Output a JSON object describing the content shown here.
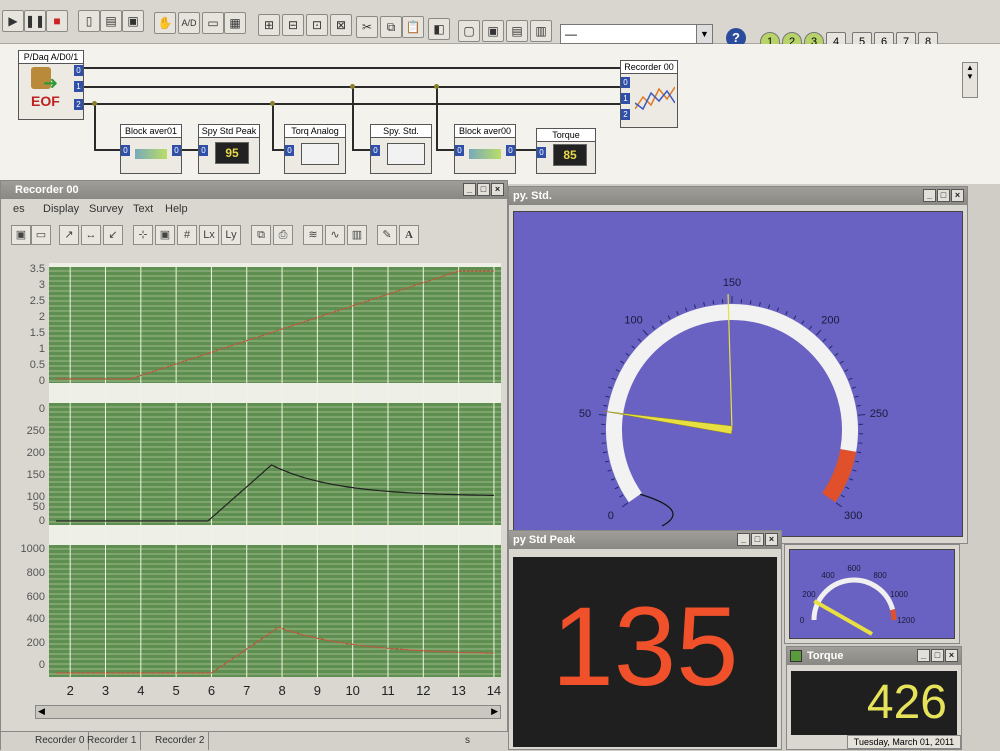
{
  "toolbar": {
    "icons": [
      "play-icon",
      "pause-icon",
      "stop-icon",
      "new-icon",
      "open-icon",
      "save-icon",
      "hand-icon",
      "ad-icon",
      "image-icon",
      "grid-icon",
      "layout1-icon",
      "layout2-icon",
      "layout3-icon",
      "cut-icon",
      "copy-icon",
      "paste-icon",
      "cube-icon",
      "win1-icon",
      "win2-icon",
      "win3-icon",
      "win4-icon"
    ],
    "combo_value": "—",
    "help_label": "?",
    "layers": [
      "1",
      "2",
      "3",
      "4",
      "5",
      "6",
      "7",
      "8"
    ]
  },
  "diagram": {
    "source": {
      "title": "P/Daq A/D0/1",
      "label": "EOF",
      "ports": [
        "0",
        "1",
        "2"
      ]
    },
    "recorder": {
      "title": "Recorder 00",
      "ports": [
        "0",
        "1",
        "2"
      ]
    },
    "blocks": [
      {
        "title": "Block aver01"
      },
      {
        "title": "Spy Std Peak",
        "value": "95"
      },
      {
        "title": "Torq Analog"
      },
      {
        "title": "Spy. Std."
      },
      {
        "title": "Block aver00"
      },
      {
        "title": "Torque",
        "value": "85"
      }
    ],
    "port_zero": "0"
  },
  "recorder_window": {
    "title": "Recorder 00",
    "menu": [
      "es",
      "Display",
      "Survey",
      "Text",
      "Help"
    ],
    "x_ticks": [
      "2",
      "3",
      "4",
      "5",
      "6",
      "7",
      "8",
      "9",
      "10",
      "11",
      "12",
      "13",
      "14"
    ],
    "panel1_ticks": [
      "3.5",
      "3",
      "2.5",
      "2",
      "1.5",
      "1",
      "0.5",
      "0"
    ],
    "panel2_ticks": [
      "0",
      "250",
      "200",
      "150",
      "100",
      "50",
      "0"
    ],
    "panel3_ticks": [
      "1000",
      "800",
      "600",
      "400",
      "200",
      "0"
    ],
    "tabs": [
      "Recorder 0",
      "Recorder 1",
      "Recorder 2"
    ],
    "unit": "s",
    "series_colors": [
      "#c8503a",
      "#222222",
      "#c8503a"
    ]
  },
  "gauge_window": {
    "title": "py. Std.",
    "ticks": [
      "0",
      "50",
      "100",
      "150",
      "200",
      "250",
      "300"
    ],
    "value": 52,
    "peak": 148,
    "background": "#6a62c2"
  },
  "peak_window": {
    "title": "py Std Peak",
    "value": "135",
    "color": "#f0502a"
  },
  "small_gauge": {
    "ticks": [
      "0",
      "200",
      "400",
      "600",
      "800",
      "1000",
      "1200"
    ],
    "value": 170
  },
  "torque_window": {
    "title": "Torque",
    "value": "426",
    "color": "#e6e35a",
    "status": "Tuesday, March 01, 2011"
  },
  "window_buttons": [
    "_",
    "□",
    "×"
  ]
}
